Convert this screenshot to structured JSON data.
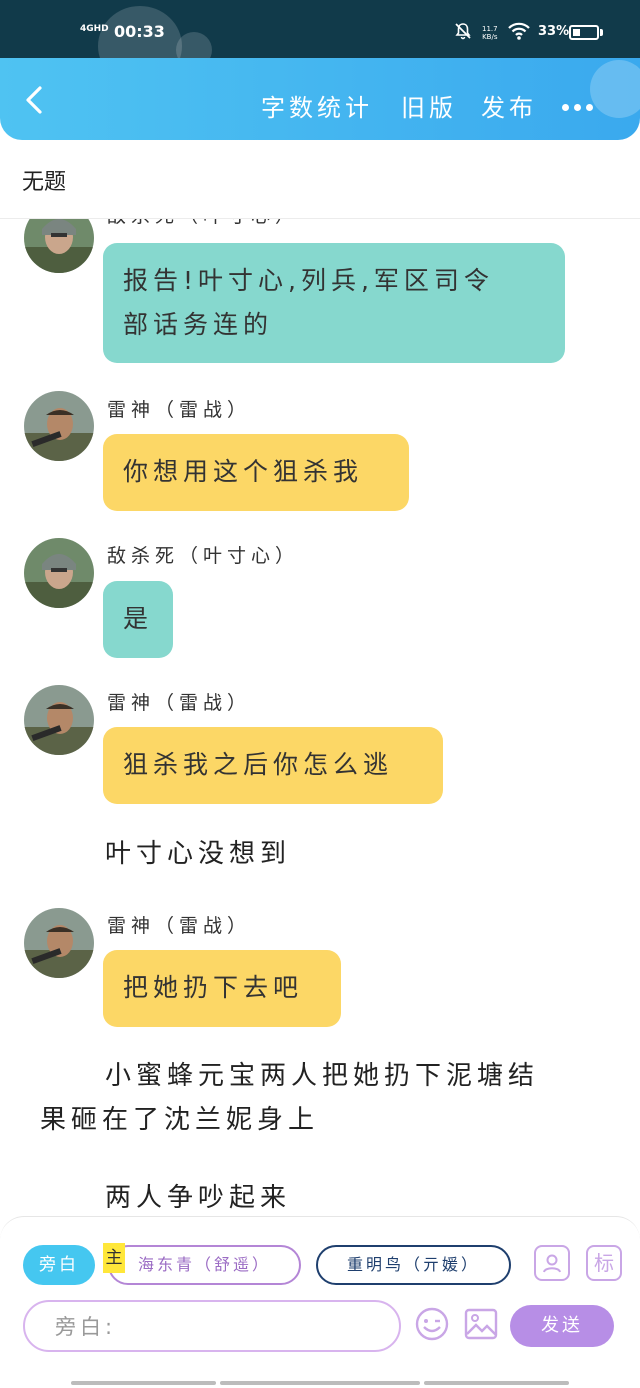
{
  "status_bar": {
    "network": "4GHD",
    "time": "00:33",
    "net_speed_value": "11.7",
    "net_speed_unit": "KB/s",
    "battery": "33%",
    "battery_level": 0.33
  },
  "app_bar": {
    "word_count": "字数统计",
    "old_version": "旧版",
    "publish": "发布"
  },
  "doc_title": "无题",
  "characters": {
    "a": {
      "name": "敌杀死（叶寸心）"
    },
    "b": {
      "name": "雷神（雷战）"
    }
  },
  "messages": [
    {
      "type": "dialogue",
      "speaker": "敌杀死（叶寸心）",
      "lines": [
        "报告!叶寸心,列兵,军区司令",
        "部话务连的"
      ]
    },
    {
      "type": "dialogue",
      "speaker": "雷神（雷战）",
      "lines": [
        "你想用这个狙杀我"
      ]
    },
    {
      "type": "dialogue",
      "speaker": "敌杀死（叶寸心）",
      "lines": [
        "是"
      ]
    },
    {
      "type": "dialogue",
      "speaker": "雷神（雷战）",
      "lines": [
        "狙杀我之后你怎么逃"
      ]
    },
    {
      "type": "narration",
      "lines": [
        "叶寸心没想到"
      ]
    },
    {
      "type": "dialogue",
      "speaker": "雷神（雷战）",
      "lines": [
        "把她扔下去吧"
      ]
    },
    {
      "type": "narration",
      "lines": [
        "小蜜蜂元宝两人把她扔下泥塘结",
        "果砸在了沈兰妮身上"
      ]
    },
    {
      "type": "narration",
      "lines": [
        "两人争吵起来"
      ]
    }
  ],
  "composer": {
    "narrator_chip": "旁白",
    "main_badge": "主",
    "role_chips": [
      "海东青（舒遥）",
      "重明鸟（亓媛）"
    ],
    "tag_button": "标",
    "input_placeholder": "旁白:",
    "send_label": "发送"
  },
  "colors": {
    "app_bar": "#4fc3f2",
    "teal_bubble": "#86d8ce",
    "yellow_bubble": "#fcd766",
    "send": "#b78ee6"
  }
}
